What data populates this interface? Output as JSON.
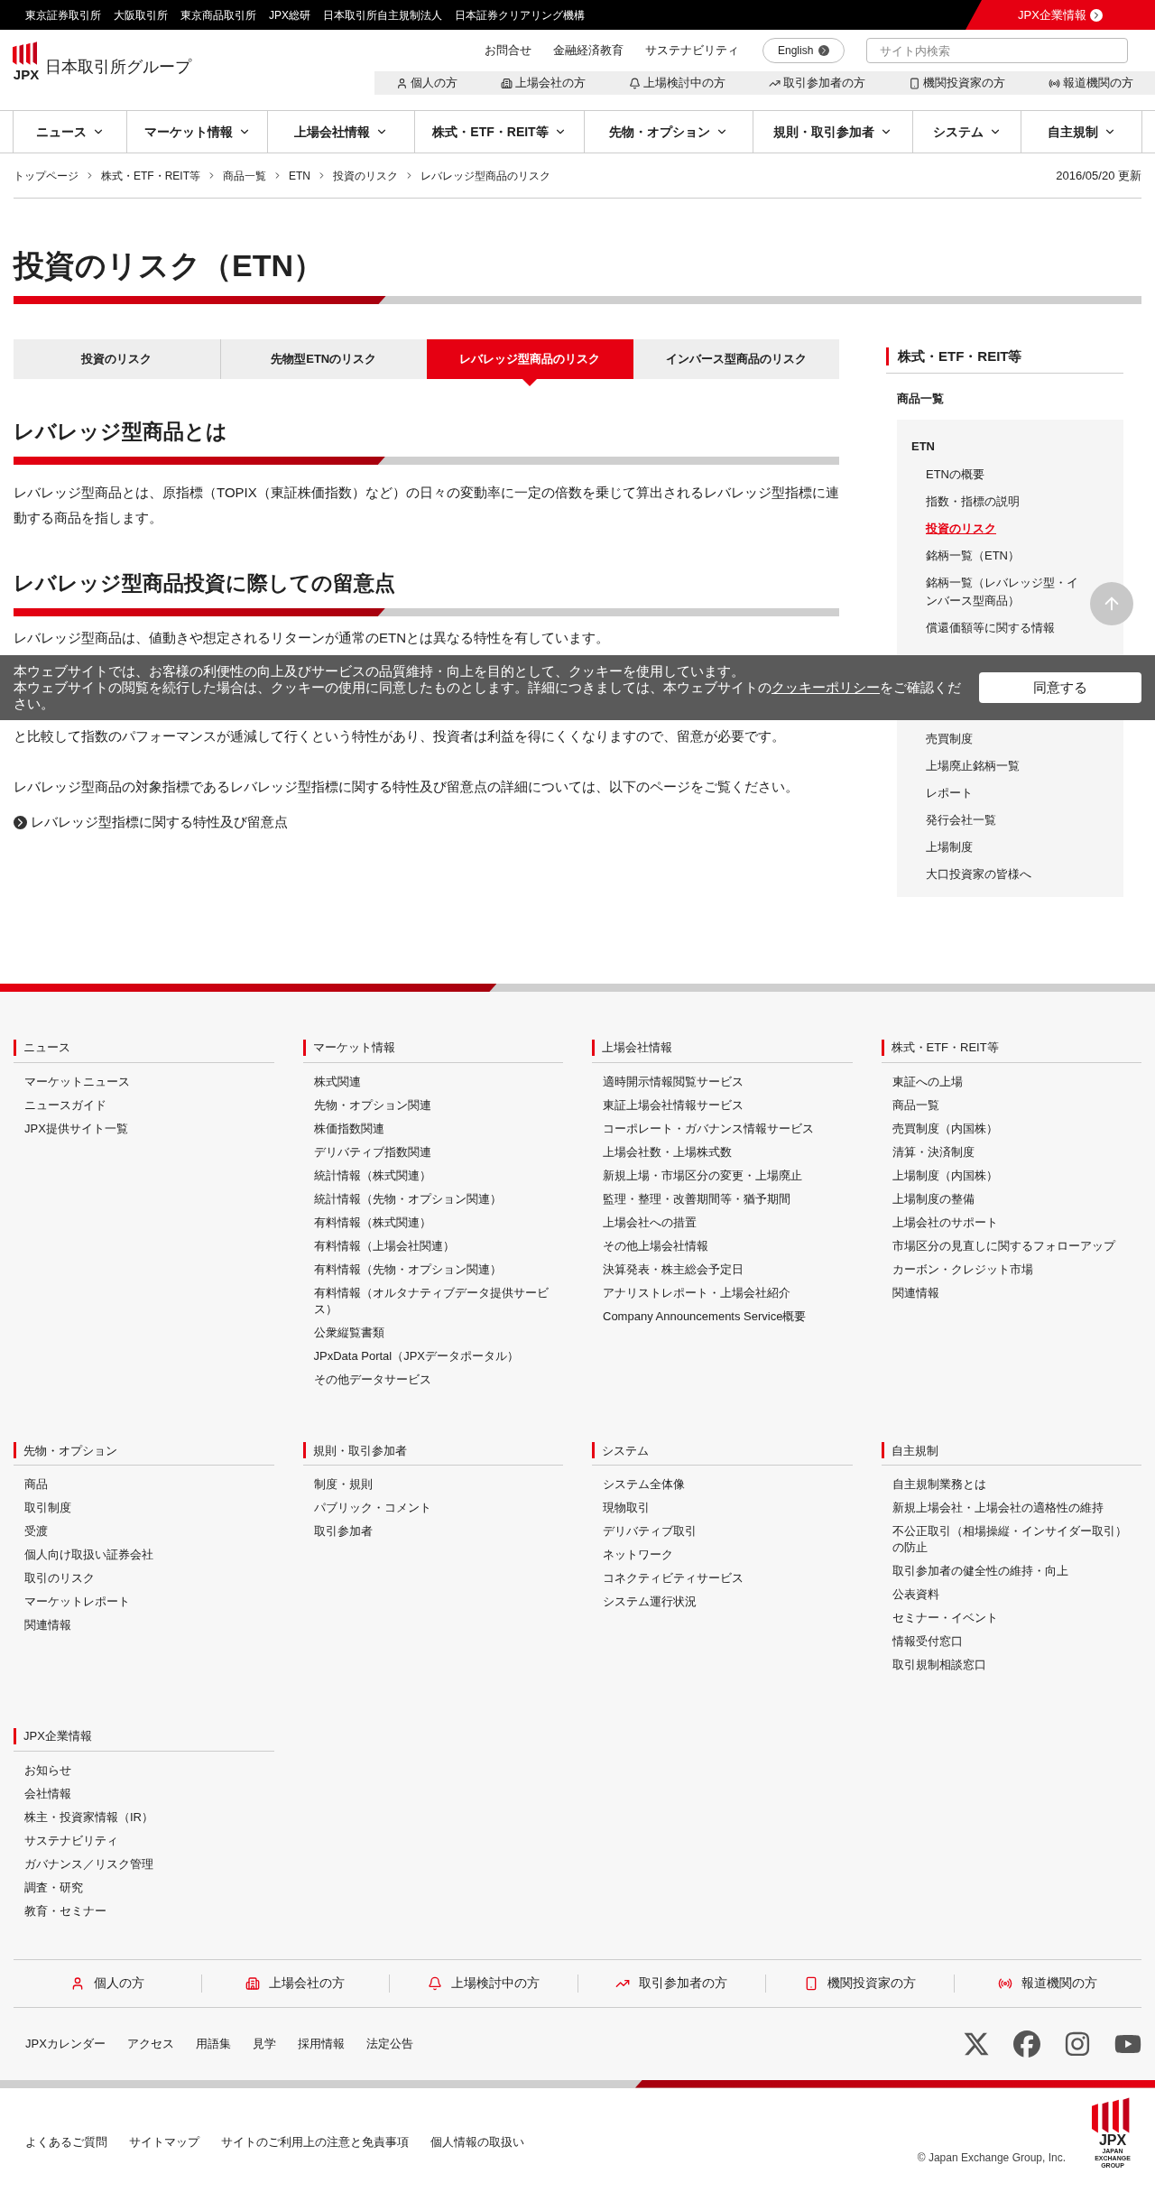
{
  "top_bar": {
    "links": [
      "東京証券取引所",
      "大阪取引所",
      "東京商品取引所",
      "JPX総研",
      "日本取引所自主規制法人",
      "日本証券クリアリング機構"
    ],
    "corporate_link": "JPX企業情報"
  },
  "header": {
    "logo_mark": "JPX",
    "logo_text": "日本取引所グループ",
    "utility_links": [
      "お問合せ",
      "金融経済教育",
      "サステナビリティ"
    ],
    "language_button": "English",
    "search": {
      "placeholder": "サイト内検索"
    },
    "audience_links": [
      {
        "kind": "person",
        "label": "個人の方"
      },
      {
        "kind": "company",
        "label": "上場会社の方"
      },
      {
        "kind": "bell",
        "label": "上場検討中の方"
      },
      {
        "kind": "chart",
        "label": "取引参加者の方"
      },
      {
        "kind": "institution",
        "label": "機関投資家の方"
      },
      {
        "kind": "press",
        "label": "報道機関の方"
      }
    ]
  },
  "main_nav": [
    "ニュース",
    "マーケット情報",
    "上場会社情報",
    "株式・ETF・REIT等",
    "先物・オプション",
    "規則・取引参加者",
    "システム",
    "自主規制"
  ],
  "breadcrumb": [
    "トップページ",
    "株式・ETF・REIT等",
    "商品一覧",
    "ETN",
    "投資のリスク",
    "レバレッジ型商品のリスク"
  ],
  "updated": "2016/05/20 更新",
  "page_title": "投資のリスク（ETN）",
  "tabs": [
    {
      "label": "投資のリスク",
      "selected": false
    },
    {
      "label": "先物型ETNのリスク",
      "selected": false
    },
    {
      "label": "レバレッジ型商品のリスク",
      "selected": true
    },
    {
      "label": "インバース型商品のリスク",
      "selected": false
    }
  ],
  "sections": [
    {
      "heading": "レバレッジ型商品とは",
      "paragraphs": [
        {
          "text": "レバレッジ型商品とは、原指標（TOPIX（東証株価指数）など）の日々の変動率に一定の倍数を乗じて算出されるレバレッジ型指標に連動する商品を指します。"
        }
      ]
    },
    {
      "heading": "レバレッジ型商品投資に際しての留意点",
      "paragraphs": [
        {
          "text": "レバレッジ型商品は、値動きや想定されるリターンが通常のETNとは異なる特性を有しています。",
          "text_after_cover": "と比較して指数のパフォーマンスが逓減して行くという特性があり、投資者は利益を得にくくなりますので、留意が必要です。"
        },
        {
          "text": "レバレッジ型商品の対象指標であるレバレッジ型指標に関する特性及び留意点の詳細については、以下のページをご覧ください。"
        }
      ],
      "link": "レバレッジ型指標に関する特性及び留意点"
    }
  ],
  "sidebar": {
    "heading": "株式・ETF・REIT等",
    "items": [
      {
        "label": "商品一覧",
        "selected": false,
        "children": [
          {
            "label": "ETN",
            "selected": false,
            "children": [
              {
                "label": "ETNの概要",
                "selected": false
              },
              {
                "label": "指数・指標の説明",
                "selected": false
              },
              {
                "label": "投資のリスク",
                "selected": true
              },
              {
                "label": "銘柄一覧（ETN）",
                "selected": false
              },
              {
                "label": "銘柄一覧（レバレッジ型・インバース型商品）",
                "selected": false
              },
              {
                "label": "償還価額等に関する情報",
                "selected": false
              },
              {
                "label": "売買制度",
                "selected": false
              },
              {
                "label": "上場廃止銘柄一覧",
                "selected": false
              },
              {
                "label": "レポート",
                "selected": false
              },
              {
                "label": "発行会社一覧",
                "selected": false
              },
              {
                "label": "上場制度",
                "selected": false
              },
              {
                "label": "大口投資家の皆様へ",
                "selected": false
              }
            ]
          }
        ]
      }
    ]
  },
  "cookie_banner": {
    "lines": [
      "本ウェブサイトでは、お客様の利便性の向上及びサービスの品質維持・向上を目的として、クッキーを使用しています。",
      "本ウェブサイトの閲覧を続行した場合は、クッキーの使用に同意したものとします。詳細につきましては、本ウェブサイトの"
    ],
    "link": "クッキーポリシー",
    "text_end": "をご確認ください。",
    "button": "同意する"
  },
  "footer": {
    "groups": [
      {
        "heading": "ニュース",
        "links": [
          "マーケットニュース",
          "ニュースガイド",
          "JPX提供サイト一覧"
        ]
      },
      {
        "heading": "マーケット情報",
        "links": [
          "株式関連",
          "先物・オプション関連",
          "株価指数関連",
          "デリバティブ指数関連",
          "統計情報（株式関連）",
          "統計情報（先物・オプション関連）",
          "有料情報（株式関連）",
          "有料情報（上場会社関連）",
          "有料情報（先物・オプション関連）",
          "有料情報（オルタナティブデータ提供サービス）",
          "公衆縦覧書類",
          "JPxData Portal（JPXデータポータル）",
          "その他データサービス"
        ]
      },
      {
        "heading": "上場会社情報",
        "links": [
          "適時開示情報閲覧サービス",
          "東証上場会社情報サービス",
          "コーポレート・ガバナンス情報サービス",
          "上場会社数・上場株式数",
          "新規上場・市場区分の変更・上場廃止",
          "監理・整理・改善期間等・猶予期間",
          "上場会社への措置",
          "その他上場会社情報",
          "決算発表・株主総会予定日",
          "アナリストレポート・上場会社紹介",
          "Company Announcements Service概要"
        ]
      },
      {
        "heading": "株式・ETF・REIT等",
        "links": [
          "東証への上場",
          "商品一覧",
          "売買制度（内国株）",
          "清算・決済制度",
          "上場制度（内国株）",
          "上場制度の整備",
          "上場会社のサポート",
          "市場区分の見直しに関するフォローアップ",
          "カーボン・クレジット市場",
          "関連情報"
        ]
      },
      {
        "heading": "先物・オプション",
        "links": [
          "商品",
          "取引制度",
          "受渡",
          "個人向け取扱い証券会社",
          "取引のリスク",
          "マーケットレポート",
          "関連情報"
        ]
      },
      {
        "heading": "規則・取引参加者",
        "links": [
          "制度・規則",
          "パブリック・コメント",
          "取引参加者"
        ]
      },
      {
        "heading": "システム",
        "links": [
          "システム全体像",
          "現物取引",
          "デリバティブ取引",
          "ネットワーク",
          "コネクティビティサービス",
          "システム運行状況"
        ]
      },
      {
        "heading": "自主規制",
        "links": [
          "自主規制業務とは",
          "新規上場会社・上場会社の適格性の維持",
          "不公正取引（相場操縦・インサイダー取引）の防止",
          "取引参加者の健全性の維持・向上",
          "公表資料",
          "セミナー・イベント",
          "情報受付窓口",
          "取引規制相談窓口"
        ]
      },
      {
        "heading": "JPX企業情報",
        "links": [
          "お知らせ",
          "会社情報",
          "株主・投資家情報（IR）",
          "サステナビリティ",
          "ガバナンス／リスク管理",
          "調査・研究",
          "教育・セミナー"
        ]
      }
    ],
    "audience_links": [
      {
        "kind": "person",
        "label": "個人の方"
      },
      {
        "kind": "company",
        "label": "上場会社の方"
      },
      {
        "kind": "bell",
        "label": "上場検討中の方"
      },
      {
        "kind": "chart",
        "label": "取引参加者の方"
      },
      {
        "kind": "institution",
        "label": "機関投資家の方"
      },
      {
        "kind": "press",
        "label": "報道機関の方"
      }
    ],
    "links": [
      "JPXカレンダー",
      "アクセス",
      "用語集",
      "見学",
      "採用情報",
      "法定公告"
    ],
    "social": [
      {
        "kind": "x"
      },
      {
        "kind": "facebook"
      },
      {
        "kind": "instagram"
      },
      {
        "kind": "youtube"
      }
    ],
    "legal_links": [
      "よくあるご質問",
      "サイトマップ",
      "サイトのご利用上の注意と免責事項",
      "個人情報の取扱い"
    ],
    "copyright": "© Japan Exchange Group, Inc.",
    "logo_mark": "JPX",
    "logo_caption": "JAPAN EXCHANGE GROUP"
  }
}
